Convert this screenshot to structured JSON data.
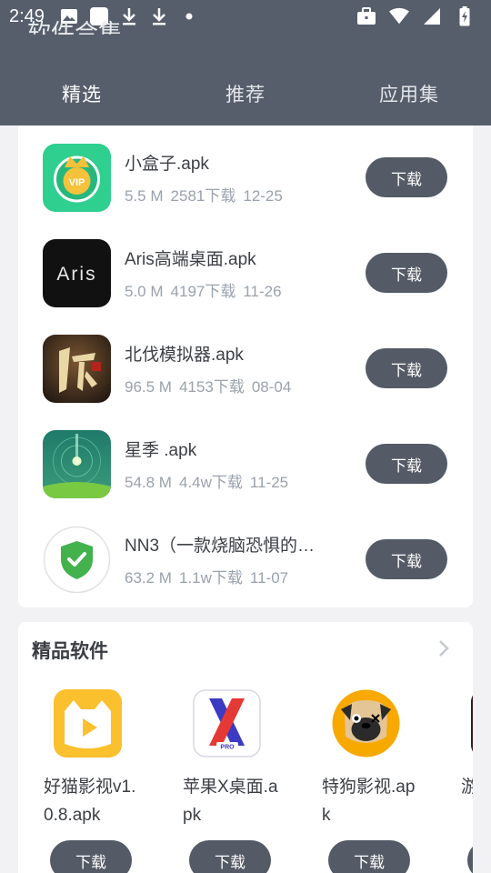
{
  "status_bar": {
    "time": "2:49"
  },
  "header": {
    "cut_title": "软件合集"
  },
  "tabs": [
    {
      "label": "精选",
      "active": true
    },
    {
      "label": "推荐",
      "active": false
    },
    {
      "label": "应用集",
      "active": false
    }
  ],
  "apps": [
    {
      "title": "小盒子.apk",
      "size": "5.5 M",
      "downloads": "2581下载",
      "date": "12-25",
      "button": "下载",
      "icon": "vip-crown-icon"
    },
    {
      "title": "Aris高端桌面.apk",
      "size": "5.0 M",
      "downloads": "4197下载",
      "date": "11-26",
      "button": "下载",
      "icon": "aris-logo-icon"
    },
    {
      "title": "北伐模拟器.apk",
      "size": "96.5 M",
      "downloads": "4153下载",
      "date": "08-04",
      "button": "下载",
      "icon": "beifa-game-icon"
    },
    {
      "title": "星季 .apk",
      "size": "54.8 M",
      "downloads": "4.4w下载",
      "date": "11-25",
      "button": "下载",
      "icon": "star-season-icon"
    },
    {
      "title": "NN3（一款烧脑恐惧的…",
      "size": "63.2 M",
      "downloads": "1.1w下载",
      "date": "11-07",
      "button": "下载",
      "icon": "shield-check-icon"
    }
  ],
  "featured": {
    "title": "精品软件",
    "items": [
      {
        "name": "好猫影视v1.0.8.apk",
        "button": "下载",
        "icon": "cat-video-icon"
      },
      {
        "name": "苹果X桌面.apk",
        "button": "下载",
        "icon": "x-launcher-icon"
      },
      {
        "name": "特狗影视.apk",
        "button": "下载",
        "icon": "pug-dog-icon"
      },
      {
        "name": "游跑",
        "button": "下载",
        "icon": "game-icon"
      }
    ]
  },
  "colors": {
    "header": "#565e6b",
    "button": "#545b66",
    "meta_text": "#9aa2ac"
  }
}
